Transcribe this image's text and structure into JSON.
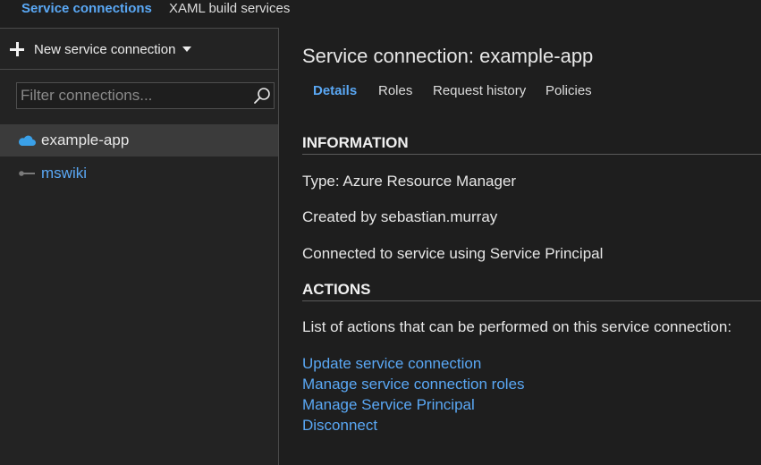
{
  "top_tabs": {
    "service_connections": "Service connections",
    "xaml_build_services": "XAML build services"
  },
  "sidebar": {
    "new_button_label": "New service connection",
    "filter_placeholder": "Filter connections...",
    "items": [
      {
        "label": "example-app",
        "icon": "cloud-icon",
        "selected": true
      },
      {
        "label": "mswiki",
        "icon": "key-icon",
        "selected": false
      }
    ]
  },
  "main": {
    "title": "Service connection: example-app",
    "tabs": [
      {
        "label": "Details",
        "active": true
      },
      {
        "label": "Roles",
        "active": false
      },
      {
        "label": "Request history",
        "active": false
      },
      {
        "label": "Policies",
        "active": false
      }
    ],
    "information": {
      "heading": "INFORMATION",
      "type_line": "Type: Azure Resource Manager",
      "created_line": "Created by sebastian.murray",
      "connected_line": "Connected to service using Service Principal"
    },
    "actions": {
      "heading": "ACTIONS",
      "description": "List of actions that can be performed on this service connection:",
      "links": [
        "Update service connection",
        "Manage service connection roles",
        "Manage Service Principal",
        "Disconnect"
      ]
    }
  },
  "colors": {
    "accent": "#5aa8f5",
    "background": "#1e1e1e",
    "sidebar_background": "#232323",
    "selected_item": "#3b3b3b"
  }
}
